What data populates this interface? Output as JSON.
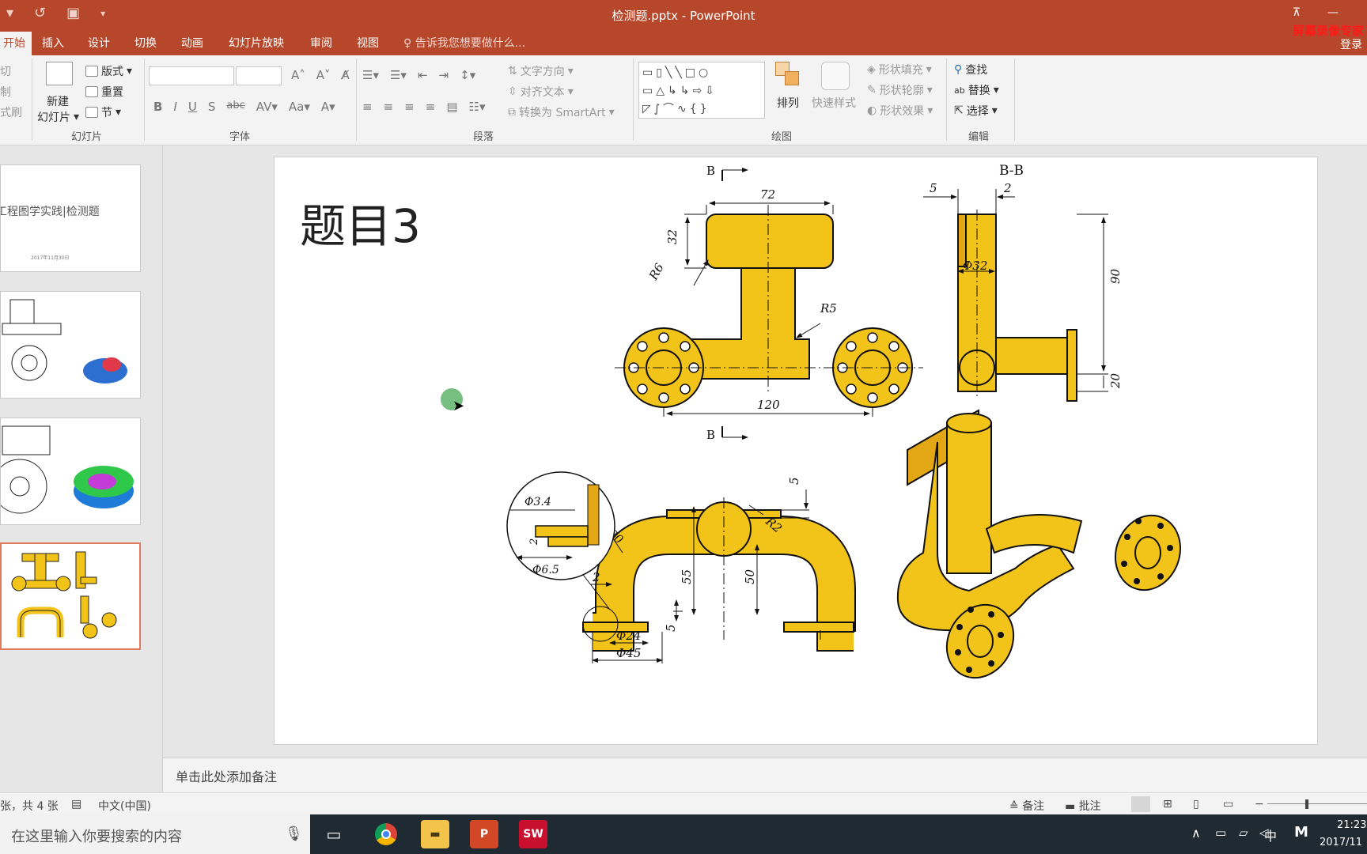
{
  "window": {
    "title": "检测题.pptx - PowerPoint",
    "recorder_label": "屏幕录像专家",
    "login": "登录"
  },
  "tabs": [
    "开始",
    "插入",
    "设计",
    "切换",
    "动画",
    "幻灯片放映",
    "审阅",
    "视图"
  ],
  "tell_me": "告诉我您想要做什么...",
  "ribbon": {
    "clipboard": {
      "cut": "切",
      "copy": "制",
      "painter": "式刷"
    },
    "slides": {
      "new_line1": "新建",
      "new_line2": "幻灯片",
      "layout": "版式",
      "reset": "重置",
      "section": "节",
      "label": "幻灯片"
    },
    "font": {
      "label": "字体"
    },
    "paragraph": {
      "text_direction": "文字方向",
      "align_text": "对齐文本",
      "smartart": "转换为 SmartArt",
      "label": "段落"
    },
    "drawing": {
      "arrange": "排列",
      "quick_styles": "快速样式",
      "fill": "形状填充",
      "outline": "形状轮廓",
      "effects": "形状效果",
      "label": "绘图"
    },
    "editing": {
      "find": "查找",
      "replace": "替换",
      "select": "选择",
      "label": "编辑"
    }
  },
  "thumbnails": [
    {
      "number": 1,
      "text": "工程图学实践|检测题",
      "date": "2017年11月30日"
    },
    {
      "number": 2
    },
    {
      "number": 3
    },
    {
      "number": 4,
      "selected": true
    }
  ],
  "slide": {
    "title": "题目3",
    "drawing": {
      "section_mark": "B",
      "section_title": "B-B",
      "dims": {
        "d72": "72",
        "d32": "32",
        "r6": "R6",
        "r5": "R5",
        "d120": "120",
        "d5a": "5",
        "d2a": "2",
        "phi32": "Φ32",
        "d90": "90",
        "d20": "20",
        "phi3_4": "Φ3.4",
        "d2b": "2",
        "phi6_5": "Φ6.5",
        "r30": "R30",
        "r2": "R2",
        "d5b": "5",
        "d55": "55",
        "d50": "50",
        "d2c": "2",
        "d5c": "5",
        "phi24": "Φ24",
        "phi45": "Φ45"
      }
    }
  },
  "notes_placeholder": "单击此处添加备注",
  "status": {
    "slide_info": "张，共 4 张",
    "language": "中文(中国)",
    "notes_btn": "备注",
    "comments_btn": "批注"
  },
  "taskbar": {
    "search_placeholder": "在这里输入你要搜索的内容",
    "time": "21:23",
    "date": "2017/11",
    "ime": "中",
    "ime2": "M"
  },
  "colors": {
    "accent": "#b7472a",
    "part_fill": "#f2c318"
  }
}
